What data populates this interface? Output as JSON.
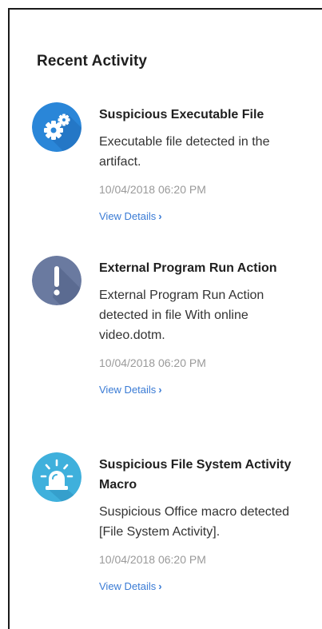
{
  "panel": {
    "title": "Recent Activity"
  },
  "colors": {
    "gear_icon_bg": "#2a86d8",
    "exclamation_icon_bg": "#6a7aa0",
    "alarm_icon_bg": "#3fb0dc",
    "link": "#3a7bd5",
    "timestamp": "#9a9a9a"
  },
  "activities": [
    {
      "icon": "gears-icon",
      "title": "Suspicious Executable File",
      "description": "Executable file detected in the artifact.",
      "timestamp": "10/04/2018 06:20 PM",
      "link_label": "View Details",
      "link_chevron": "›"
    },
    {
      "icon": "exclamation-icon",
      "title": "External Program Run Action",
      "description": "External Program Run Action detected in file With online video.dotm.",
      "timestamp": "10/04/2018 06:20 PM",
      "link_label": "View Details",
      "link_chevron": "›"
    },
    {
      "icon": "alarm-light-icon",
      "title": "Suspicious File System Activity Macro",
      "description": "Suspicious Office macro detected [File System Activity].",
      "timestamp": "10/04/2018 06:20 PM",
      "link_label": "View Details",
      "link_chevron": "›"
    }
  ]
}
